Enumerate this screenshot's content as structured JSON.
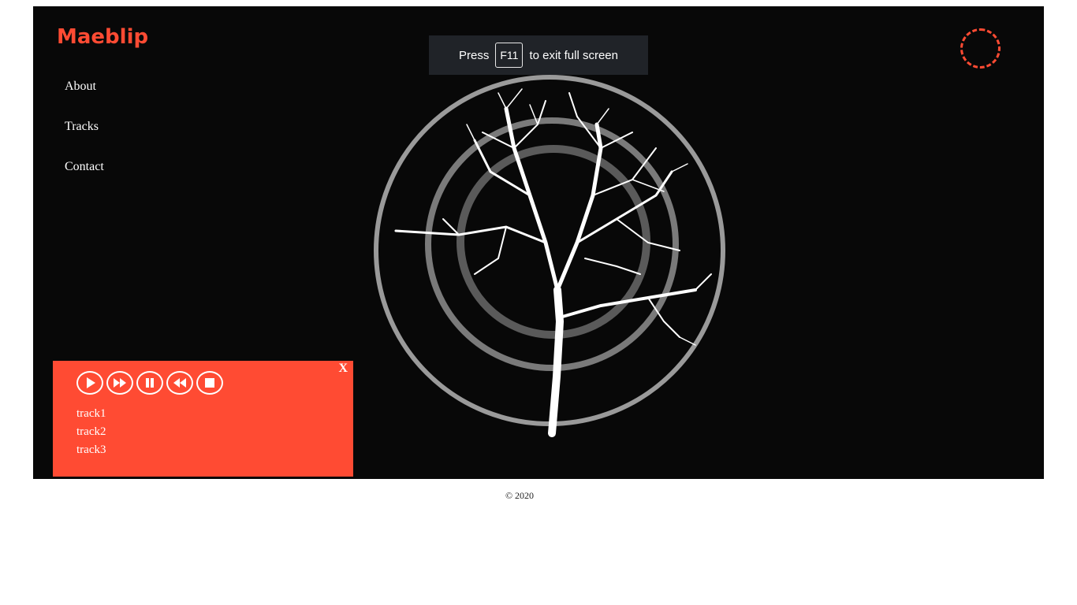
{
  "brand": {
    "name": "Maeblip",
    "accent_color": "#ff4b33"
  },
  "nav": {
    "items": [
      {
        "label": "About"
      },
      {
        "label": "Tracks"
      },
      {
        "label": "Contact"
      }
    ]
  },
  "fullscreen_notice": {
    "prefix": "Press",
    "key": "F11",
    "suffix": "to exit full screen"
  },
  "visual": {
    "subject": "bare tree",
    "ring_count": 3,
    "ring_color": "#9a9a9a"
  },
  "player": {
    "close_label": "X",
    "controls": [
      {
        "name": "play",
        "icon": "play-icon"
      },
      {
        "name": "fast-forward",
        "icon": "fast-forward-icon"
      },
      {
        "name": "pause",
        "icon": "pause-icon"
      },
      {
        "name": "rewind",
        "icon": "rewind-icon"
      },
      {
        "name": "stop",
        "icon": "stop-icon"
      }
    ],
    "tracks": [
      {
        "label": "track1"
      },
      {
        "label": "track2"
      },
      {
        "label": "track3"
      }
    ],
    "background_color": "#ff4b33"
  },
  "footer": {
    "text": "© 2020"
  }
}
